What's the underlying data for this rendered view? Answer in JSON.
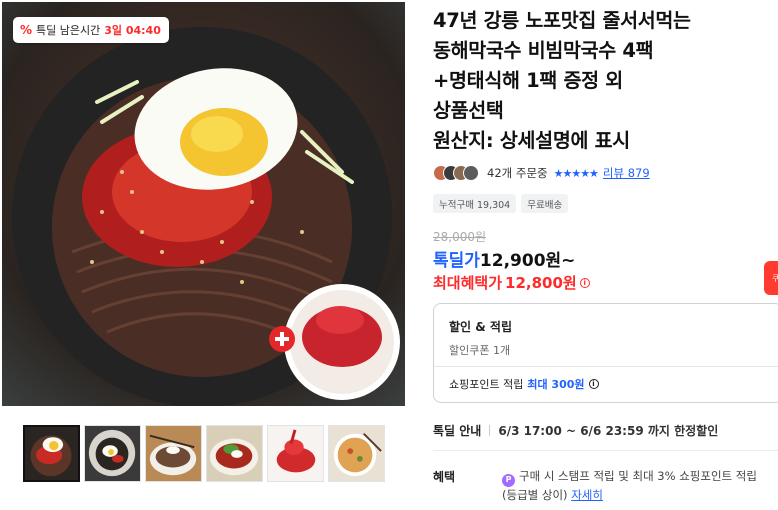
{
  "deal_badge": {
    "prefix": "특딜 남은시간",
    "remaining": "3일 04:40"
  },
  "icons": {
    "deal": "percent-tag-icon",
    "add": "plus-circle-icon",
    "info": "info-circle-icon",
    "points": "point-badge-icon"
  },
  "thumbnails": [
    {
      "name": "thumb-bibim-noodles",
      "active": true
    },
    {
      "name": "thumb-mul-noodles",
      "active": false
    },
    {
      "name": "thumb-noodle-bowl",
      "active": false
    },
    {
      "name": "thumb-spicy-noodles",
      "active": false
    },
    {
      "name": "thumb-myeongtae-sikhae",
      "active": false
    },
    {
      "name": "thumb-pancake",
      "active": false
    }
  ],
  "title": "47년 강릉 노포맛집 줄서서먹는\n동해막국수 비빔막국수 4팩\n+명태식해 1팩 증정 외\n상품선택\n원산지: 상세설명에 표시",
  "social": {
    "orders": "42개 주문중",
    "stars": "★★★★★",
    "review": "리뷰 879"
  },
  "chips": [
    "누적구매 19,304",
    "무료배송"
  ],
  "price": {
    "original": "28,000원",
    "deal_label": "톡딜가",
    "deal_value": "12,900원~",
    "max_label": "최대혜택가",
    "max_value": "12,800원"
  },
  "side_tab": "쿠",
  "benefit_box": {
    "title": "할인 & 적립",
    "coupon": "할인쿠폰 1개",
    "points_label": "쇼핑포인트 적립",
    "points_max": "최대 300원"
  },
  "deal_info": {
    "label": "톡딜 안내",
    "value": "6/3 17:00 ~ 6/6 23:59 까지 한정할인"
  },
  "benefit": {
    "label": "혜택",
    "line1": "구매 시 스탬프 적립 및 최대 3% 쇼핑포인트 적립",
    "line2": "(등급별 상이)",
    "link": "자세히"
  },
  "colors": {
    "accent_blue": "#2163ff",
    "accent_red": "#ff2b2b",
    "purple": "#a26bff"
  }
}
